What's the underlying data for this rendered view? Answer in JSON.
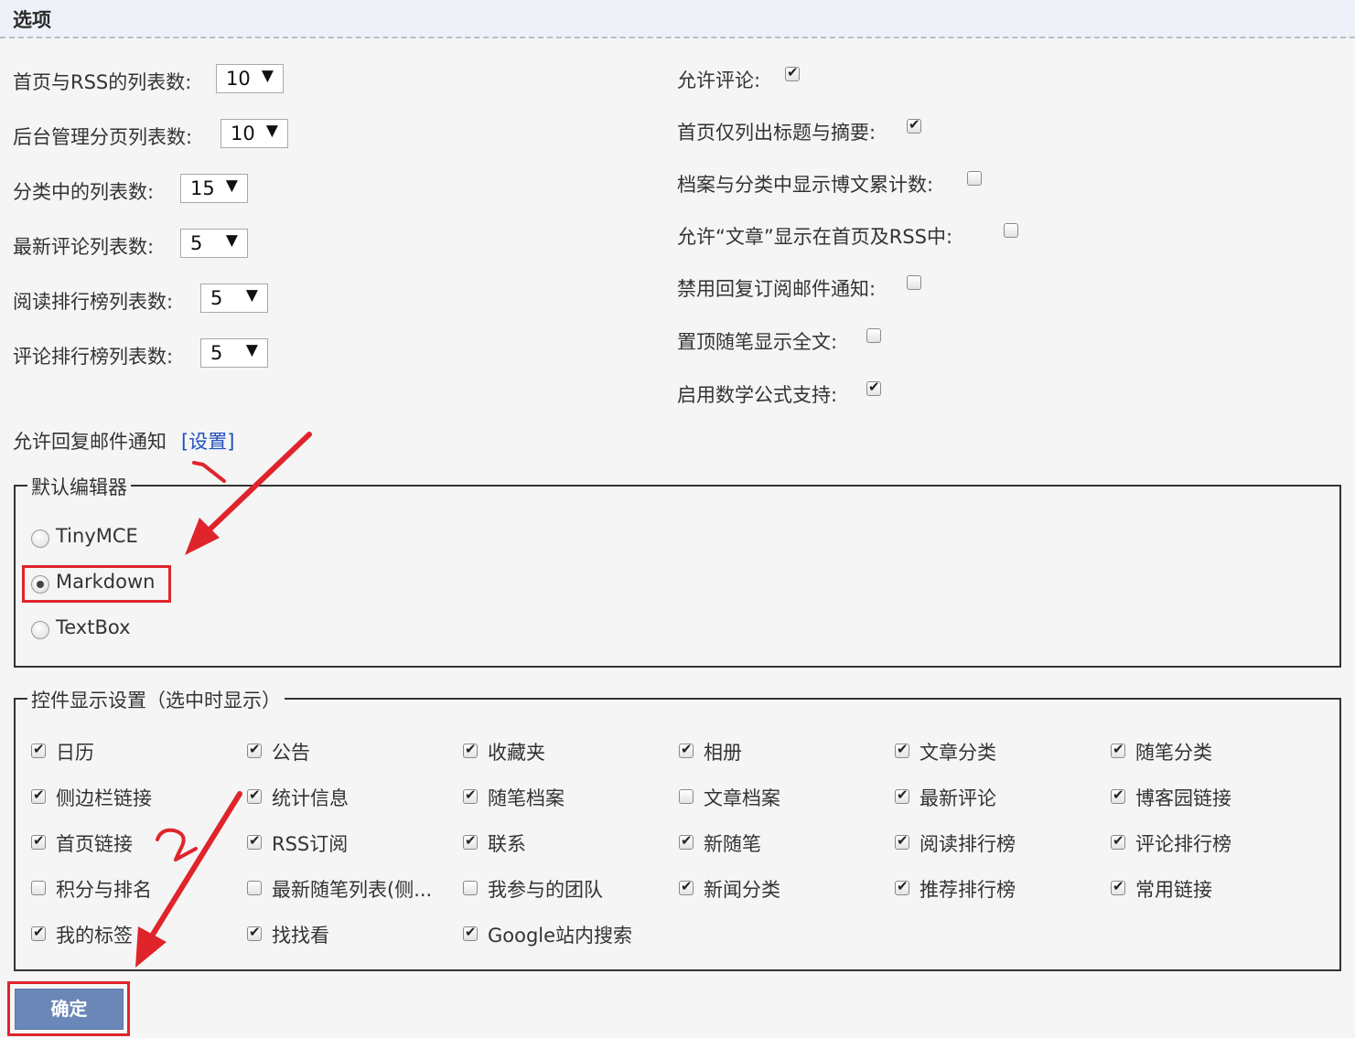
{
  "header": {
    "title": "选项"
  },
  "left_settings": [
    {
      "label": "首页与RSS的列表数:",
      "value": "10"
    },
    {
      "label": "后台管理分页列表数:",
      "value": "10"
    },
    {
      "label": "分类中的列表数:",
      "value": "15"
    },
    {
      "label": "最新评论列表数:",
      "value": "5"
    },
    {
      "label": "阅读排行榜列表数:",
      "value": "5"
    },
    {
      "label": "评论排行榜列表数:",
      "value": "5"
    }
  ],
  "right_settings": [
    {
      "label": "允许评论:",
      "checked": true
    },
    {
      "label": "首页仅列出标题与摘要:",
      "checked": true
    },
    {
      "label": "档案与分类中显示博文累计数:",
      "checked": false
    },
    {
      "label": "允许“文章”显示在首页及RSS中:",
      "checked": false
    },
    {
      "label": "禁用回复订阅邮件通知:",
      "checked": false
    },
    {
      "label": "置顶随笔显示全文:",
      "checked": false
    },
    {
      "label": "启用数学公式支持:",
      "checked": true
    }
  ],
  "reply_mail": {
    "text": "允许回复邮件通知",
    "link": "[设置]"
  },
  "editor": {
    "legend": "默认编辑器",
    "options": [
      {
        "label": "TinyMCE",
        "selected": false
      },
      {
        "label": "Markdown",
        "selected": true
      },
      {
        "label": "TextBox",
        "selected": false
      }
    ]
  },
  "widgets": {
    "legend": "控件显示设置（选中时显示）",
    "items": [
      {
        "label": "日历",
        "checked": true
      },
      {
        "label": "公告",
        "checked": true
      },
      {
        "label": "收藏夹",
        "checked": true
      },
      {
        "label": "相册",
        "checked": true
      },
      {
        "label": "文章分类",
        "checked": true
      },
      {
        "label": "随笔分类",
        "checked": true
      },
      {
        "label": "侧边栏链接",
        "checked": true
      },
      {
        "label": "统计信息",
        "checked": true
      },
      {
        "label": "随笔档案",
        "checked": true
      },
      {
        "label": "文章档案",
        "checked": false
      },
      {
        "label": "最新评论",
        "checked": true
      },
      {
        "label": "博客园链接",
        "checked": true
      },
      {
        "label": "首页链接",
        "checked": true
      },
      {
        "label": "RSS订阅",
        "checked": true
      },
      {
        "label": "联系",
        "checked": true
      },
      {
        "label": "新随笔",
        "checked": true
      },
      {
        "label": "阅读排行榜",
        "checked": true
      },
      {
        "label": "评论排行榜",
        "checked": true
      },
      {
        "label": "积分与排名",
        "checked": false
      },
      {
        "label": "最新随笔列表(侧...",
        "checked": false
      },
      {
        "label": "我参与的团队",
        "checked": false
      },
      {
        "label": "新闻分类",
        "checked": true
      },
      {
        "label": "推荐排行榜",
        "checked": true
      },
      {
        "label": "常用链接",
        "checked": true
      },
      {
        "label": "我的标签",
        "checked": true
      },
      {
        "label": "找找看",
        "checked": true
      },
      {
        "label": "Google站内搜索",
        "checked": true
      }
    ]
  },
  "submit": {
    "label": "确定"
  },
  "annotations": {
    "colour": "#e0242c"
  }
}
